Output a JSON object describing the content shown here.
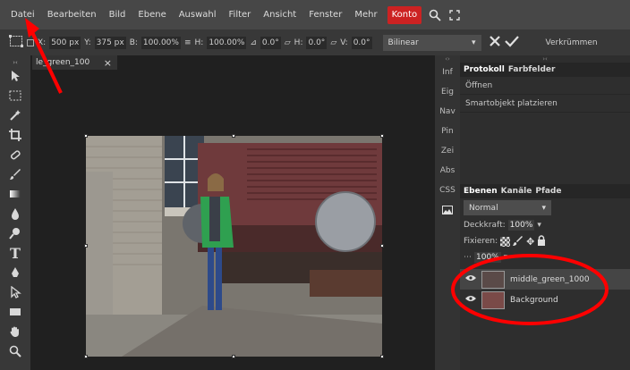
{
  "menubar": {
    "items": [
      "Datei",
      "Bearbeiten",
      "Bild",
      "Ebene",
      "Auswahl",
      "Filter",
      "Ansicht",
      "Fenster",
      "Mehr"
    ],
    "account": "Konto",
    "icons": [
      "search-icon",
      "fullscreen-icon"
    ]
  },
  "options": {
    "x_label": "X:",
    "x_value": "500 px",
    "y_label": "Y:",
    "y_value": "375 px",
    "w_label": "B:",
    "w_value": "100.00%",
    "h_label": "H:",
    "h_value": "100.00%",
    "angle_value": "0.0°",
    "hskew_label": "H:",
    "hskew_value": "0.0°",
    "vskew_label": "V:",
    "vskew_value": "0.0°",
    "interpolation": "Bilinear",
    "warp_label": "Verkrümmen"
  },
  "document": {
    "tab_title": "le_green_100",
    "close": "×"
  },
  "collapsed_panels": [
    "Inf",
    "Eig",
    "Nav",
    "Pin",
    "Zei",
    "Abs",
    "CSS"
  ],
  "history": {
    "tabs": [
      "Protokoll",
      "Farbfelder"
    ],
    "items": [
      "Öffnen",
      "Smartobjekt platzieren"
    ]
  },
  "layers": {
    "tabs": [
      "Ebenen",
      "Kanäle",
      "Pfade"
    ],
    "blend_mode": "Normal",
    "opacity_label": "Deckkraft:",
    "opacity_value": "100%",
    "lock_label": "Fixieren:",
    "fill_value": "100%",
    "items": [
      {
        "name": "middle_green_1000",
        "selected": true
      },
      {
        "name": "Background",
        "selected": false
      }
    ]
  },
  "colors": {
    "menubar": "#474747",
    "accent_red": "#cc2222",
    "panel": "#2e2e2e",
    "annotation": "#ff0000"
  }
}
